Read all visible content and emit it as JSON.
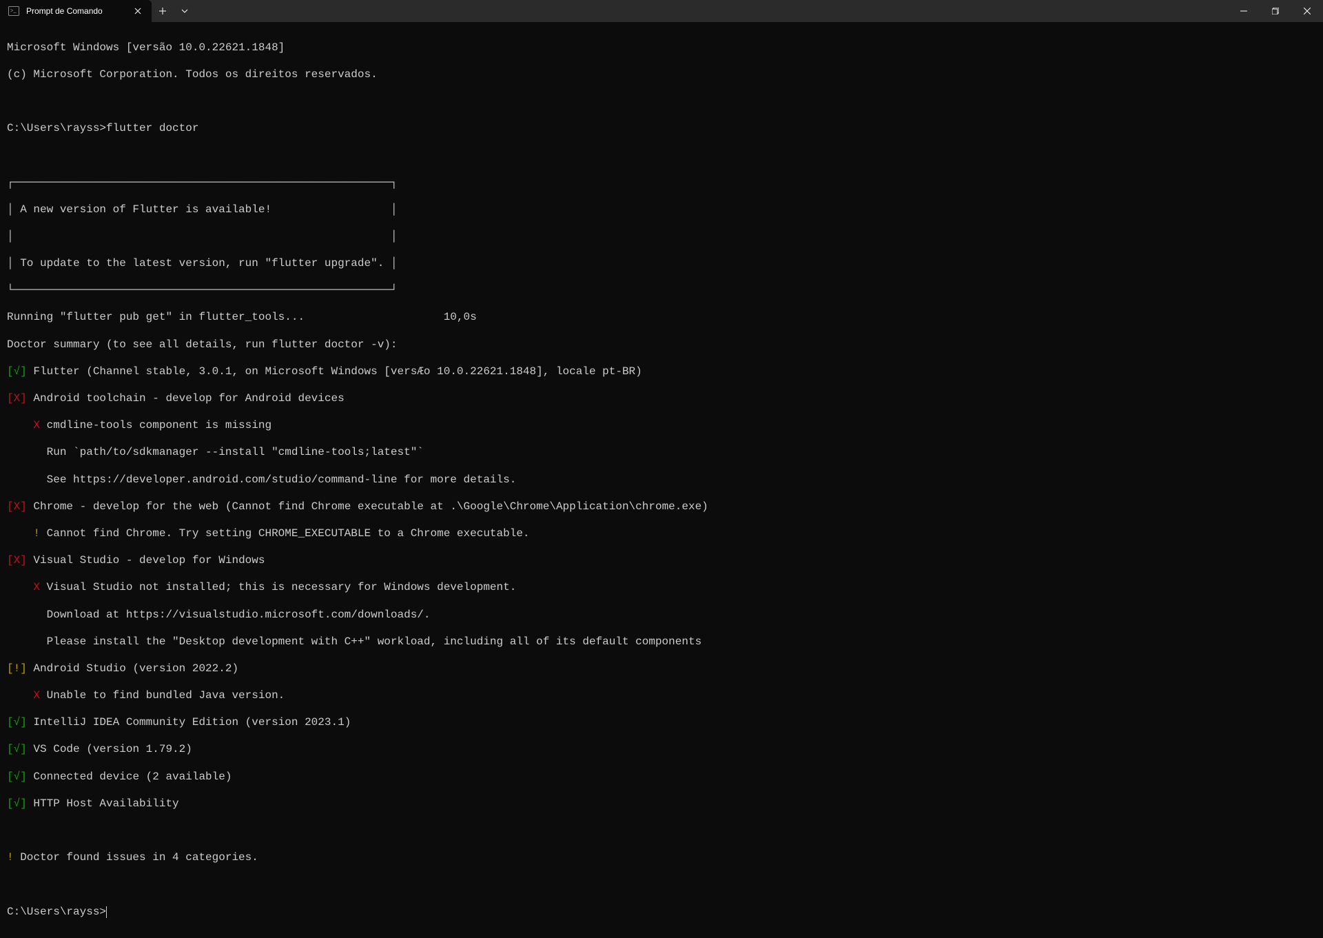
{
  "titlebar": {
    "tab_title": "Prompt de Comando"
  },
  "header": {
    "os_line": "Microsoft Windows [versão 10.0.22621.1848]",
    "copyright": "(c) Microsoft Corporation. Todos os direitos reservados."
  },
  "prompt1": {
    "path": "C:\\Users\\rayss>",
    "command": "flutter doctor"
  },
  "update_box": {
    "line1": "A new version of Flutter is available!",
    "line2": "To update to the latest version, run \"flutter upgrade\"."
  },
  "running_line": "Running \"flutter pub get\" in flutter_tools...                     10,0s",
  "summary_line": "Doctor summary (to see all details, run flutter doctor -v):",
  "checks": {
    "flutter": {
      "status": "[√]",
      "text": " Flutter (Channel stable, 3.0.1, on Microsoft Windows [versÆo 10.0.22621.1848], locale pt-BR)"
    },
    "android_toolchain": {
      "status": "[X]",
      "text": " Android toolchain - develop for Android devices",
      "sub1_mark": "    X ",
      "sub1_text": "cmdline-tools component is missing",
      "sub2": "      Run `path/to/sdkmanager --install \"cmdline-tools;latest\"`",
      "sub3": "      See https://developer.android.com/studio/command-line for more details."
    },
    "chrome": {
      "status": "[X]",
      "text": " Chrome - develop for the web (Cannot find Chrome executable at .\\Google\\Chrome\\Application\\chrome.exe)",
      "sub1_mark": "    ! ",
      "sub1_text": "Cannot find Chrome. Try setting CHROME_EXECUTABLE to a Chrome executable."
    },
    "visual_studio": {
      "status": "[X]",
      "text": " Visual Studio - develop for Windows",
      "sub1_mark": "    X ",
      "sub1_text": "Visual Studio not installed; this is necessary for Windows development.",
      "sub2": "      Download at https://visualstudio.microsoft.com/downloads/.",
      "sub3": "      Please install the \"Desktop development with C++\" workload, including all of its default components"
    },
    "android_studio": {
      "status": "[!]",
      "text": " Android Studio (version 2022.2)",
      "sub1_mark": "    X ",
      "sub1_text": "Unable to find bundled Java version."
    },
    "intellij": {
      "status": "[√]",
      "text": " IntelliJ IDEA Community Edition (version 2023.1)"
    },
    "vscode": {
      "status": "[√]",
      "text": " VS Code (version 1.79.2)"
    },
    "connected": {
      "status": "[√]",
      "text": " Connected device (2 available)"
    },
    "http": {
      "status": "[√]",
      "text": " HTTP Host Availability"
    }
  },
  "issues_line_mark": "! ",
  "issues_line_text": "Doctor found issues in 4 categories.",
  "prompt2": {
    "path": "C:\\Users\\rayss>"
  },
  "box_chars": {
    "top": "┌─────────────────────────────────────────────────────────┐",
    "empty": "│                                                         │",
    "bottom": "└─────────────────────────────────────────────────────────┘",
    "l1": "│ A new version of Flutter is available!                  │",
    "l2": "│                                                         │",
    "l3": "│ To update to the latest version, run \"flutter upgrade\". │"
  }
}
